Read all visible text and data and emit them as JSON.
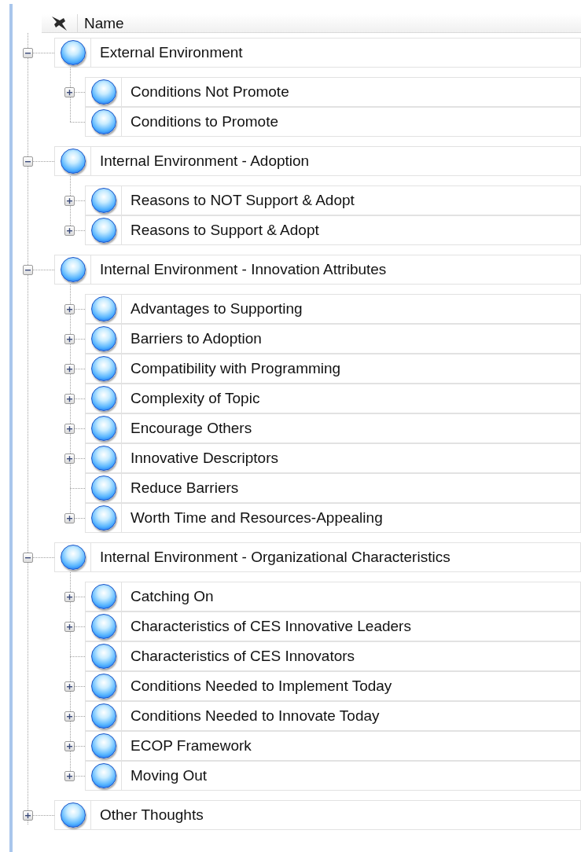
{
  "header": {
    "column": "Name"
  },
  "nodes": [
    {
      "label": "External Environment",
      "has_children": true,
      "expanded": true,
      "children": [
        {
          "label": "Conditions Not Promote",
          "has_children": true
        },
        {
          "label": "Conditions to Promote",
          "has_children": false
        }
      ]
    },
    {
      "label": "Internal Environment - Adoption",
      "has_children": true,
      "expanded": true,
      "children": [
        {
          "label": "Reasons to NOT Support & Adopt",
          "has_children": true
        },
        {
          "label": "Reasons to Support & Adopt",
          "has_children": true
        }
      ]
    },
    {
      "label": "Internal Environment - Innovation Attributes",
      "has_children": true,
      "expanded": true,
      "children": [
        {
          "label": "Advantages to Supporting",
          "has_children": true
        },
        {
          "label": "Barriers to Adoption",
          "has_children": true
        },
        {
          "label": "Compatibility with Programming",
          "has_children": true
        },
        {
          "label": "Complexity of Topic",
          "has_children": true
        },
        {
          "label": "Encourage Others",
          "has_children": true
        },
        {
          "label": "Innovative Descriptors",
          "has_children": true
        },
        {
          "label": "Reduce Barriers",
          "has_children": false
        },
        {
          "label": "Worth Time and Resources-Appealing",
          "has_children": true
        }
      ]
    },
    {
      "label": "Internal Environment - Organizational Characteristics",
      "has_children": true,
      "expanded": true,
      "children": [
        {
          "label": "Catching On",
          "has_children": true
        },
        {
          "label": "Characteristics of CES Innovative Leaders",
          "has_children": true
        },
        {
          "label": "Characteristics of CES Innovators",
          "has_children": false
        },
        {
          "label": "Conditions Needed to Implement Today",
          "has_children": true
        },
        {
          "label": "Conditions Needed to Innovate Today",
          "has_children": true
        },
        {
          "label": "ECOP Framework",
          "has_children": true
        },
        {
          "label": "Moving Out",
          "has_children": true
        }
      ]
    },
    {
      "label": "Other Thoughts",
      "has_children": true,
      "expanded": false
    }
  ]
}
